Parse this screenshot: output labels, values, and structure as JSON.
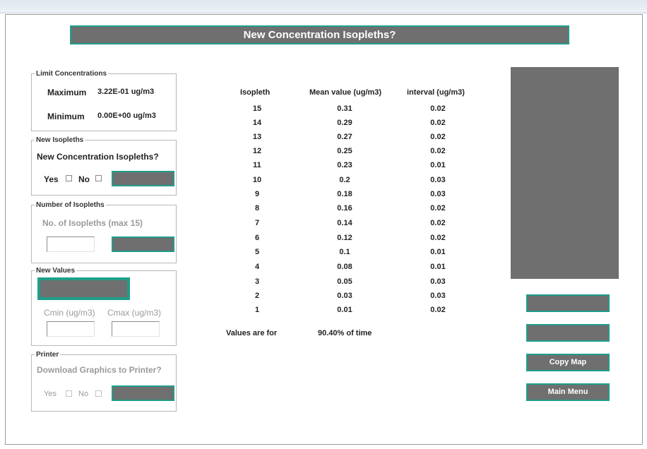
{
  "banner": {
    "title": "New Concentration Isopleths?"
  },
  "limit_panel": {
    "legend": "Limit Concentrations",
    "max_label": "Maximum",
    "max_value": "3.22E-01 ug/m3",
    "min_label": "Minimum",
    "min_value": "0.00E+00 ug/m3"
  },
  "isopleth_panel": {
    "legend": "New Isopleths",
    "question": "New Concentration Isopleths?",
    "yes_label": "Yes",
    "no_label": "No",
    "button_label": ""
  },
  "count_panel": {
    "legend": "Number of Isopleths",
    "prompt": "No. of Isopleths (max 15)",
    "input_value": "",
    "button_label": ""
  },
  "values_panel": {
    "legend": "New Values",
    "button_label": "",
    "cmin_label": "Cmin (ug/m3)",
    "cmax_label": "Cmax (ug/m3)",
    "cmin_value": "",
    "cmax_value": ""
  },
  "printer_panel": {
    "legend": "Printer",
    "question": "Download Graphics to Printer?",
    "yes_label": "Yes",
    "no_label": "No",
    "button_label": ""
  },
  "table": {
    "headers": [
      "Isopleth",
      "Mean value (ug/m3)",
      "interval (ug/m3)"
    ],
    "rows": [
      [
        "15",
        "0.31",
        "0.02"
      ],
      [
        "14",
        "0.29",
        "0.02"
      ],
      [
        "13",
        "0.27",
        "0.02"
      ],
      [
        "12",
        "0.25",
        "0.02"
      ],
      [
        "11",
        "0.23",
        "0.01"
      ],
      [
        "10",
        "0.2",
        "0.03"
      ],
      [
        "9",
        "0.18",
        "0.03"
      ],
      [
        "8",
        "0.16",
        "0.02"
      ],
      [
        "7",
        "0.14",
        "0.02"
      ],
      [
        "6",
        "0.12",
        "0.02"
      ],
      [
        "5",
        "0.1",
        "0.01"
      ],
      [
        "4",
        "0.08",
        "0.01"
      ],
      [
        "3",
        "0.05",
        "0.03"
      ],
      [
        "2",
        "0.03",
        "0.03"
      ],
      [
        "1",
        "0.01",
        "0.02"
      ]
    ],
    "footer_label": "Values are for",
    "footer_value": "90.40% of time"
  },
  "right_buttons": {
    "button1_label": "",
    "button2_label": "",
    "copy_map_label": "Copy Map",
    "main_menu_label": "Main Menu"
  },
  "colors": {
    "button_fill": "#6f6f6f",
    "button_border": "#1e9e8a",
    "disabled_text": "#9a9a9a"
  }
}
